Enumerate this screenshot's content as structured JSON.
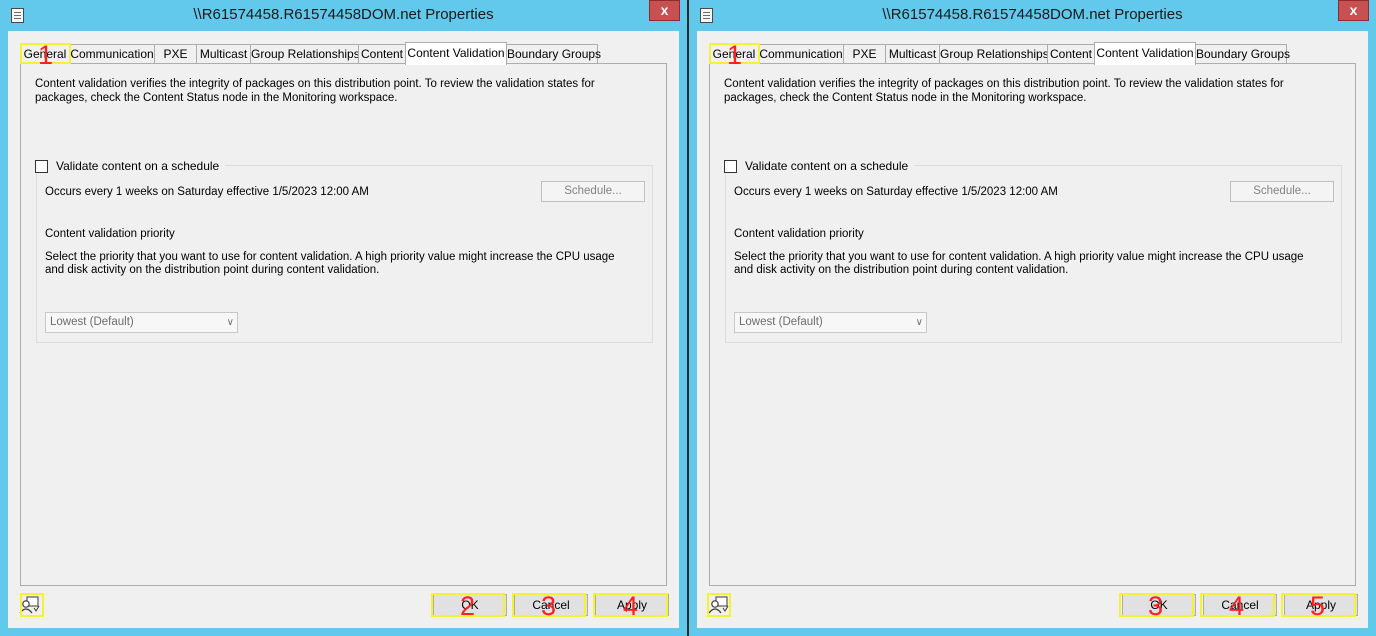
{
  "dialogs": [
    {
      "title": "\\\\R61574458.R61574458DOM.net Properties",
      "close_label": "x",
      "tabs": [
        "General",
        "Communication",
        "PXE",
        "Multicast",
        "Group Relationships",
        "Content",
        "Content Validation",
        "Boundary Groups"
      ],
      "active_tab": "Content Validation",
      "description": "Content validation verifies the integrity of packages on this distribution point. To review the validation states for packages, check the Content Status node in the Monitoring workspace.",
      "schedule_checkbox_label": "Validate content on a schedule",
      "schedule_checked": false,
      "occurs_text": "Occurs every 1 weeks on Saturday effective 1/5/2023 12:00 AM",
      "schedule_button": "Schedule...",
      "priority_label": "Content validation priority",
      "priority_desc": "Select the priority that you want to use for content validation. A high priority value might increase the CPU usage and disk activity on the distribution point during content validation.",
      "priority_value": "Lowest (Default)",
      "buttons": {
        "ok": "OK",
        "cancel": "Cancel",
        "apply": "Apply"
      },
      "markers": {
        "general_tab": "1",
        "ok": "2",
        "cancel": "3",
        "apply": "4"
      }
    },
    {
      "title": "\\\\R61574458.R61574458DOM.net Properties",
      "close_label": "x",
      "tabs": [
        "General",
        "Communication",
        "PXE",
        "Multicast",
        "Group Relationships",
        "Content",
        "Content Validation",
        "Boundary Groups"
      ],
      "active_tab": "Content Validation",
      "description": "Content validation verifies the integrity of packages on this distribution point. To review the validation states for packages, check the Content Status node in the Monitoring workspace.",
      "schedule_checkbox_label": "Validate content on a schedule",
      "schedule_checked": false,
      "occurs_text": "Occurs every 1 weeks on Saturday effective 1/5/2023 12:00 AM",
      "schedule_button": "Schedule...",
      "priority_label": "Content validation priority",
      "priority_desc": "Select the priority that you want to use for content validation. A high priority value might increase the CPU usage and disk activity on the distribution point during content validation.",
      "priority_value": "Lowest (Default)",
      "buttons": {
        "ok": "OK",
        "cancel": "Cancel",
        "apply": "Apply"
      },
      "markers": {
        "general_tab": "1",
        "ok": "3",
        "cancel": "4",
        "apply": "5"
      }
    }
  ],
  "colors": {
    "titlebar": "#62c9ec",
    "close": "#c75050",
    "highlight": "#f5f235",
    "marker": "#ff1f1f"
  }
}
